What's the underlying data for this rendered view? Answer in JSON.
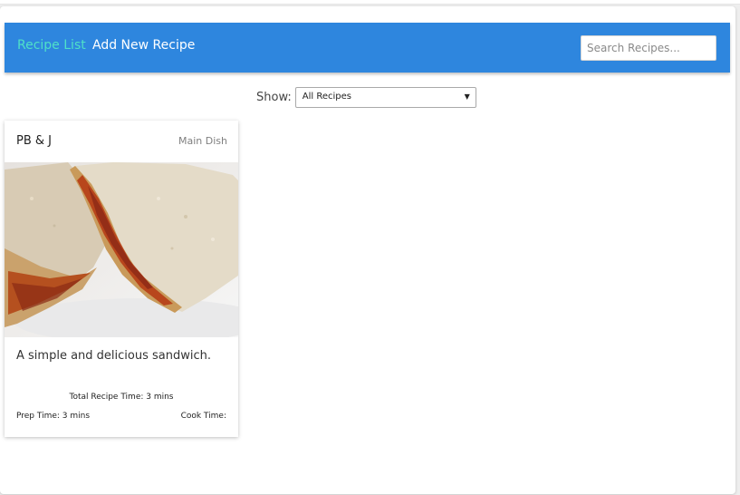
{
  "nav": {
    "recipe_list_label": "Recipe List",
    "add_recipe_label": "Add New Recipe",
    "search_placeholder": "Search Recipes..."
  },
  "filter": {
    "label": "Show:",
    "selected": "All Recipes"
  },
  "recipes": [
    {
      "title": "PB & J",
      "category": "Main Dish",
      "image_icon": "sandwich-photo",
      "description": "A simple and delicious sandwich.",
      "total_time": "Total Recipe Time: 3 mins",
      "prep_time": "Prep Time: 3 mins",
      "cook_time": "Cook Time:"
    }
  ],
  "colors": {
    "navbar": "#2e86de",
    "active_link": "#4fe0c8",
    "link": "#ffffff"
  }
}
